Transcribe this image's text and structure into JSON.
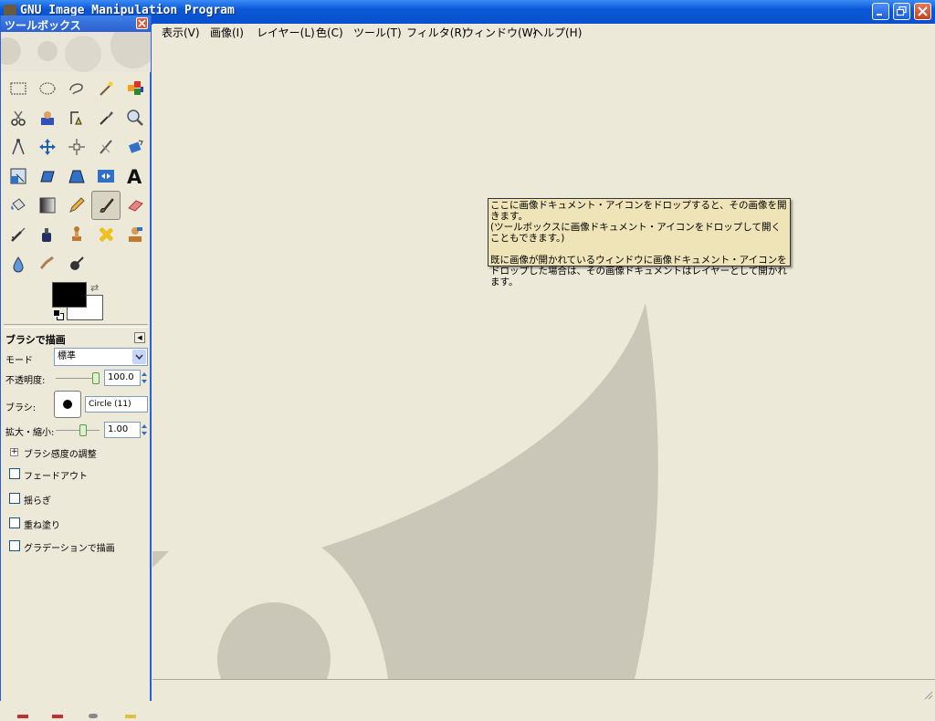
{
  "window": {
    "title": "GNU Image Manipulation Program"
  },
  "toolbox": {
    "title": "ツールボックス",
    "tools": [
      "rect-select-icon",
      "ellipse-select-icon",
      "free-select-icon",
      "fuzzy-select-icon",
      "color-select-icon",
      "scissors-icon",
      "foreground-select-icon",
      "paths-icon",
      "color-picker-icon",
      "zoom-icon",
      "measure-icon",
      "move-icon",
      "align-icon",
      "crop-icon",
      "rotate-icon",
      "scale-icon",
      "shear-icon",
      "perspective-icon",
      "flip-icon",
      "text-icon",
      "bucket-fill-icon",
      "blend-icon",
      "pencil-icon",
      "paintbrush-icon",
      "eraser-icon",
      "airbrush-icon",
      "ink-icon",
      "clone-icon",
      "heal-icon",
      "perspective-clone-icon",
      "blur-icon",
      "smudge-icon",
      "dodge-burn-icon"
    ],
    "colors": {
      "foreground": "#000000",
      "background": "#ffffff"
    }
  },
  "tool_options": {
    "title": "ブラシで描画",
    "mode_label": "モード",
    "mode_value": "標準",
    "opacity_label": "不透明度:",
    "opacity_value": "100.0",
    "opacity_level": 1.0,
    "brush_label": "ブラシ:",
    "brush_name": "Circle (11)",
    "scale_label": "拡大・縮小:",
    "scale_value": "1.00",
    "sensitivity_label": "ブラシ感度の調整",
    "checkboxes": [
      {
        "label": "フェードアウト",
        "checked": false
      },
      {
        "label": "揺らぎ",
        "checked": false
      },
      {
        "label": "重ね塗り",
        "checked": false
      },
      {
        "label": "グラデーションで描画",
        "checked": false
      }
    ]
  },
  "menubar": {
    "items": [
      "表示(V)",
      "画像(I)",
      "レイヤー(L)",
      "色(C)",
      "ツール(T)",
      "フィルタ(R)",
      "ウィンドウ(W)",
      "ヘルプ(H)"
    ]
  },
  "tooltip": {
    "line1": "ここに画像ドキュメント・アイコンをドロップすると、その画像を開きます。",
    "line2": "(ツールボックスに画像ドキュメント・アイコンをドロップして開くこともできます。)",
    "line3": "既に画像が開かれているウィンドウに画像ドキュメント・アイコンをドロップした場合は、その画像ドキュメントはレイヤーとして開かれます。"
  }
}
